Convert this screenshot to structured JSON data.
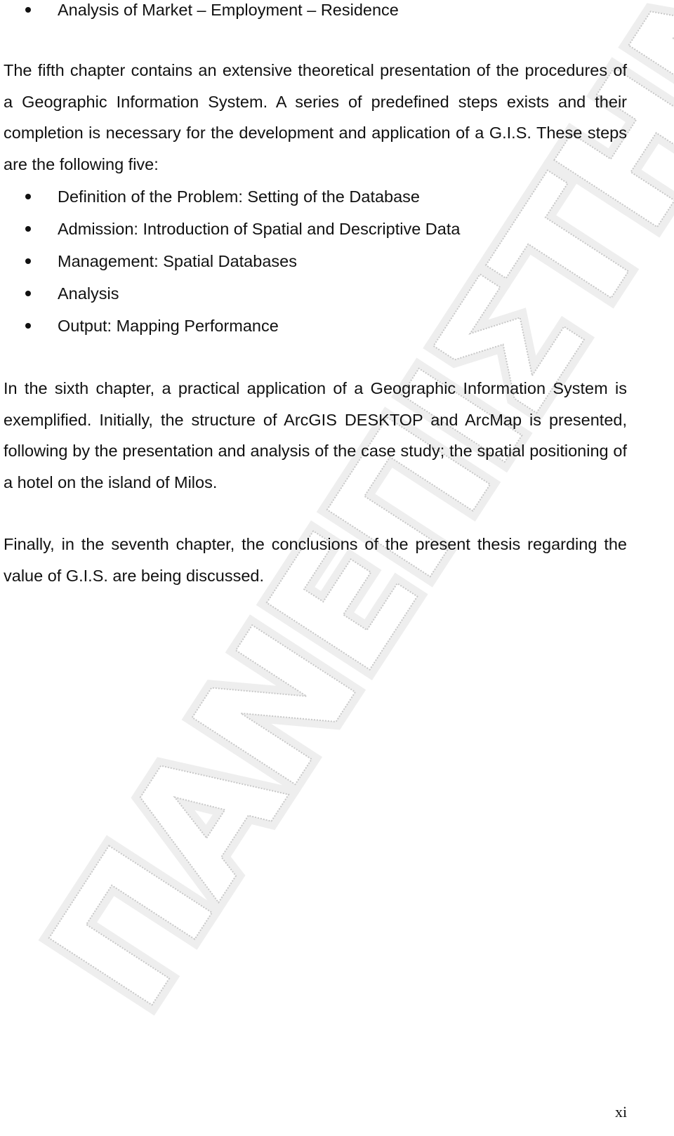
{
  "document": {
    "top_bullet": "Analysis of Market – Employment – Residence",
    "paragraphs": {
      "fifth_chapter": "The fifth chapter contains an extensive theoretical presentation of the procedures of a Geographic Information System. A series of predefined steps exists and their completion is necessary for the development and application of a G.I.S. These steps are the following five:",
      "sixth_chapter": "In the sixth chapter, a practical application of a Geographic Information System is exemplified. Initially, the structure of ArcGIS DESKTOP and ArcMap is presented, following by the presentation and analysis of the case study; the spatial positioning of a hotel on the island of Milos.",
      "seventh_chapter": "Finally, in the seventh chapter, the conclusions of the present thesis regarding the value of G.I.S. are being discussed."
    },
    "steps": [
      "Definition of the Problem: Setting of the Database",
      "Admission: Introduction of Spatial and Descriptive Data",
      "Management: Spatial Databases",
      "Analysis",
      "Output: Mapping Performance"
    ],
    "page_number": "xi"
  },
  "watermark": {
    "text": "ΠΑΝΕΠΙΣΤΗΜΙΟ ΠΕΙΡΑΙΑ",
    "color": "#c8c8c8"
  }
}
